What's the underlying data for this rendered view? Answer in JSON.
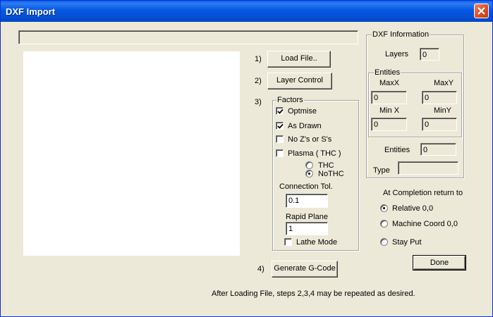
{
  "window": {
    "title": "DXF Import"
  },
  "steps": {
    "step1_num": "1)",
    "load_file": "Load File..",
    "step2_num": "2)",
    "layer_control": "Layer Control",
    "step3_num": "3)",
    "step4_num": "4)",
    "generate_gcode": "Generate G-Code"
  },
  "factors": {
    "legend": "Factors",
    "optimise": {
      "label": "Optmise",
      "checked": true
    },
    "as_drawn": {
      "label": "As Drawn",
      "checked": true
    },
    "no_zs": {
      "label": "No Z's or S's",
      "checked": false
    },
    "plasma": {
      "label": "Plasma ( THC )",
      "checked": false
    },
    "thc_label": "THC",
    "nothc_label": "NoTHC",
    "thc_selected": "NoTHC",
    "connection_tol_label": "Connection Tol.",
    "connection_tol_value": "0.1",
    "rapid_plane_label": "Rapid Plane",
    "rapid_plane_value": "1",
    "lathe_mode": {
      "label": "Lathe Mode",
      "checked": false
    }
  },
  "dxf_info": {
    "legend": "DXF Information",
    "layers_label": "Layers",
    "layers_value": "0",
    "entities_group_legend": "Entities",
    "maxx_label": "MaxX",
    "maxx_value": "0",
    "maxy_label": "MaxY",
    "maxy_value": "0",
    "minx_label": "Min X",
    "minx_value": "0",
    "miny_label": "MinY",
    "miny_value": "0",
    "entities_label": "Entities",
    "entities_value": "0",
    "type_label": "Type",
    "type_value": ""
  },
  "completion": {
    "title": "At Completion return to",
    "relative": "Relative 0,0",
    "machine": "Machine Coord 0,0",
    "stay": "Stay Put",
    "selected": "relative"
  },
  "done_label": "Done",
  "footer_note": "After Loading File, steps 2,3,4 may be repeated as desired.",
  "top_field_value": ""
}
